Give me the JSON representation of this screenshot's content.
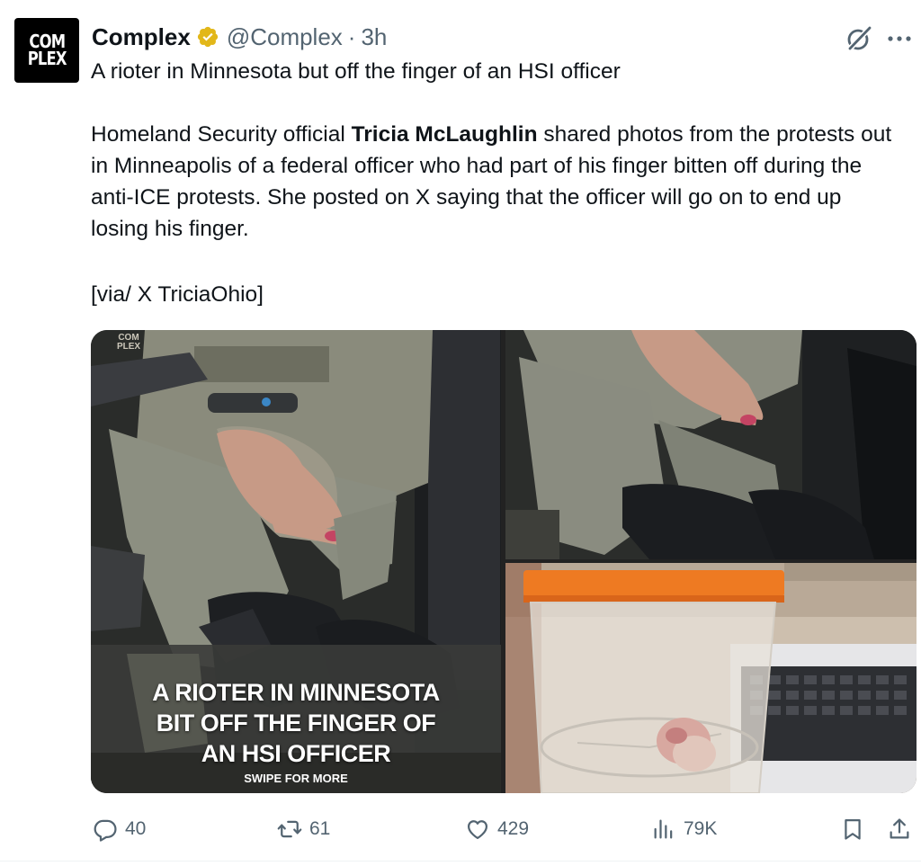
{
  "author": {
    "avatar_text_line1": "COM",
    "avatar_text_line2": "PLEX",
    "name": "Complex",
    "handle": "@Complex",
    "separator": "·",
    "time": "3h"
  },
  "post": {
    "title": "A rioter in Minnesota but off the finger of an HSI officer",
    "body_before": "Homeland Security official ",
    "body_bold": "Tricia McLaughlin",
    "body_after": " shared photos from the protests out in Minneapolis of a federal officer who had part of his finger bitten off during the anti-ICE protests. She posted on X saying that the officer will go on to end up losing his finger.",
    "via": "[via/ X TriciaOhio]"
  },
  "media": {
    "overlay_line1": "A RIOTER IN MINNESOTA",
    "overlay_line2": "BIT OFF THE FINGER OF",
    "overlay_line3": "AN HSI OFFICER",
    "swipe": "SWIPE FOR MORE",
    "watermark_line1": "COM",
    "watermark_line2": "PLEX"
  },
  "actions": {
    "replies": "40",
    "reposts": "61",
    "likes": "429",
    "views": "79K"
  },
  "colors": {
    "text": "#0f1419",
    "secondary": "#536471",
    "verified_gold": "#e2b719"
  },
  "icons": [
    "verified-badge-icon",
    "grok-icon",
    "more-icon",
    "reply-icon",
    "repost-icon",
    "like-icon",
    "views-icon",
    "bookmark-icon",
    "share-icon"
  ]
}
